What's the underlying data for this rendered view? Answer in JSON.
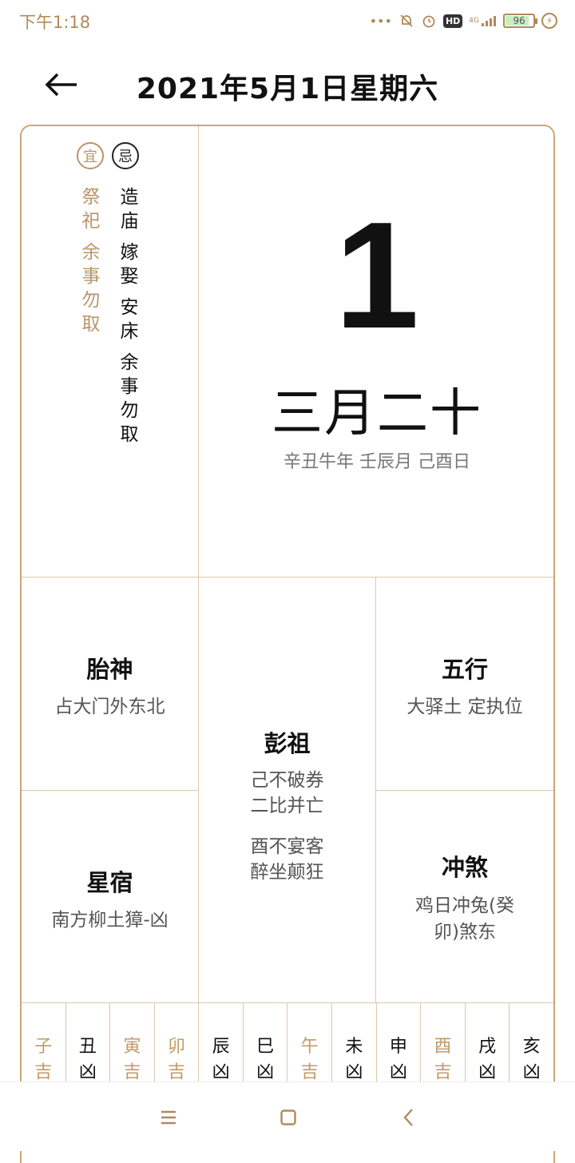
{
  "status_bar": {
    "time": "下午1:18",
    "dots": "•••",
    "network": "4G",
    "battery": "96",
    "hd": "HD"
  },
  "header": {
    "title": "2021年5月1日星期六"
  },
  "yi": {
    "badge": "宜",
    "items": [
      "祭祀",
      "余事勿取"
    ]
  },
  "ji": {
    "badge": "忌",
    "items": [
      "造庙",
      "嫁娶",
      "安床",
      "余事勿取"
    ]
  },
  "day": {
    "number": "1",
    "lunar": "三月二十",
    "ganzhi": "辛丑牛年 壬辰月 己酉日"
  },
  "taishen": {
    "title": "胎神",
    "text": "占大门外东北"
  },
  "wuxing": {
    "title": "五行",
    "text": "大驿土 定执位"
  },
  "pengzu": {
    "title": "彭祖",
    "line1": "己不破券",
    "line2": "二比并亡",
    "line3": "酉不宴客",
    "line4": "醉坐颠狂"
  },
  "xingsu": {
    "title": "星宿",
    "text": "南方柳土獐-凶"
  },
  "chongsha": {
    "title": "冲煞",
    "line1": "鸡日冲兔(癸",
    "line2": "卯)煞东"
  },
  "hours": [
    {
      "zhi": "子",
      "luck": "吉"
    },
    {
      "zhi": "丑",
      "luck": "凶"
    },
    {
      "zhi": "寅",
      "luck": "吉"
    },
    {
      "zhi": "卯",
      "luck": "吉"
    },
    {
      "zhi": "辰",
      "luck": "凶"
    },
    {
      "zhi": "巳",
      "luck": "凶"
    },
    {
      "zhi": "午",
      "luck": "吉"
    },
    {
      "zhi": "未",
      "luck": "凶"
    },
    {
      "zhi": "申",
      "luck": "凶"
    },
    {
      "zhi": "酉",
      "luck": "吉"
    },
    {
      "zhi": "戌",
      "luck": "凶"
    },
    {
      "zhi": "亥",
      "luck": "凶"
    }
  ],
  "colors": {
    "accent_gold": "#b9956a",
    "border": "#c9a878",
    "text": "#111111",
    "muted": "#777777"
  }
}
